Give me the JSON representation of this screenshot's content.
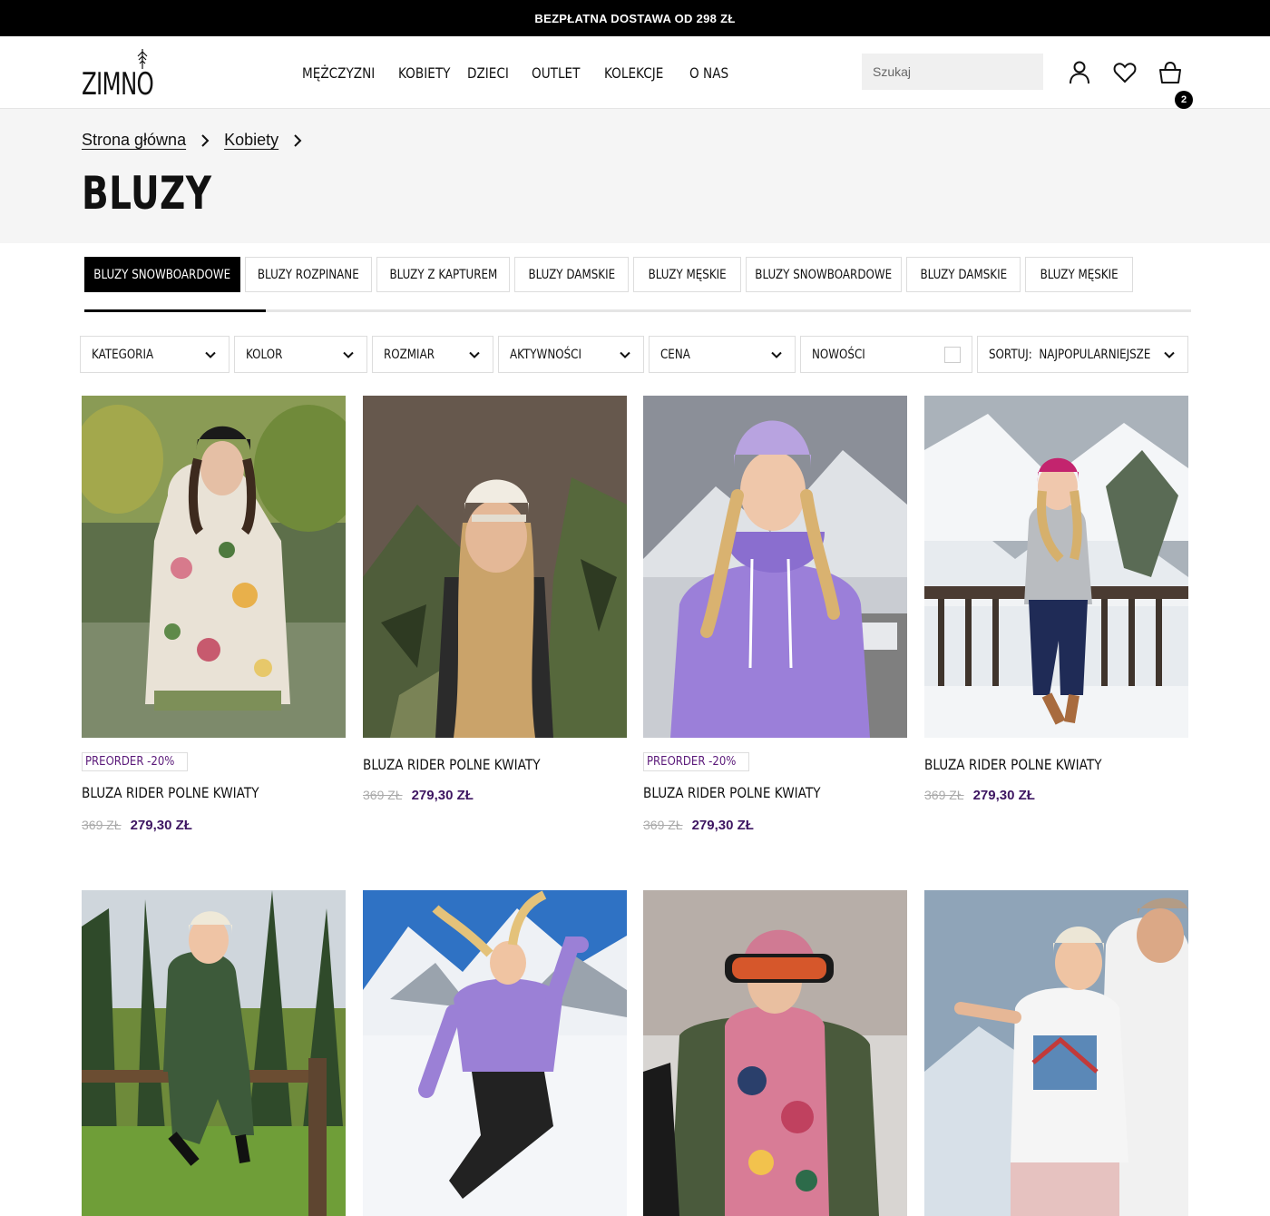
{
  "topbar": {
    "text": "BEZPŁATNA DOSTAWA OD 298 ZŁ"
  },
  "header": {
    "logo": "ZIMNO",
    "nav": [
      "MĘŻCZYZNI",
      "KOBIETY",
      "DZIECI",
      "OUTLET",
      "KOLEKCJE",
      "O NAS"
    ],
    "search_placeholder": "Szukaj",
    "cart_count": "2"
  },
  "breadcrumb": {
    "home": "Strona główna",
    "parent": "Kobiety"
  },
  "page_title": "BLUZY",
  "chips": [
    {
      "label": "BLUZY SNOWBOARDOWE",
      "active": true
    },
    {
      "label": "BLUZY ROZPINANE",
      "active": false
    },
    {
      "label": "BLUZY Z KAPTUREM",
      "active": false
    },
    {
      "label": "BLUZY DAMSKIE",
      "active": false
    },
    {
      "label": "BLUZY MĘSKIE",
      "active": false
    },
    {
      "label": "BLUZY SNOWBOARDOWE",
      "active": false
    },
    {
      "label": "BLUZY DAMSKIE",
      "active": false
    },
    {
      "label": "BLUZY MĘSKIE",
      "active": false
    }
  ],
  "chips_scroll_fraction": 0.164,
  "filters": {
    "kategoria": "KATEGORIA",
    "kolor": "KOLOR",
    "rozmiar": "ROZMIAR",
    "aktywnosci": "AKTYWNOŚCI",
    "cena": "CENA",
    "nowosci": "NOWOŚCI",
    "sort_label": "SORTUJ:",
    "sort_value": "NAJPOPULARNIEJSZE"
  },
  "products": [
    {
      "badge": "PREORDER -20%",
      "name": "BLUZA RIDER POLNE KWIATY",
      "old_price": "369 ZŁ",
      "price": "279,30 ZŁ"
    },
    {
      "badge": "",
      "name": "BLUZA RIDER POLNE KWIATY",
      "old_price": "369 ZŁ",
      "price": "279,30 ZŁ"
    },
    {
      "badge": "PREORDER -20%",
      "name": "BLUZA RIDER POLNE KWIATY",
      "old_price": "369 ZŁ",
      "price": "279,30 ZŁ"
    },
    {
      "badge": "",
      "name": "BLUZA RIDER POLNE KWIATY",
      "old_price": "369 ZŁ",
      "price": "279,30 ZŁ"
    }
  ],
  "colors": {
    "accent_price": "#3e1662",
    "badge_text": "#5b1a7a",
    "hero_bg": "#f5f5f5"
  }
}
